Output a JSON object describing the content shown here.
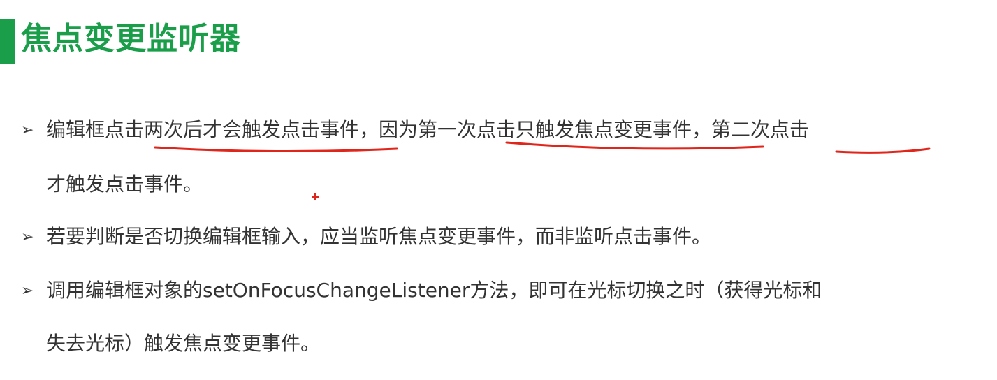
{
  "slide": {
    "title": "焦点变更监听器",
    "bullet_glyph": "➢",
    "bullets": [
      {
        "lines": [
          "编辑框点击两次后才会触发点击事件，因为第一次点击只触发焦点变更事件，第二次点击",
          "才触发点击事件。"
        ]
      },
      {
        "lines": [
          "若要判断是否切换编辑框输入，应当监听焦点变更事件，而非监听点击事件。"
        ]
      },
      {
        "lines": [
          "调用编辑框对象的setOnFocusChangeListener方法，即可在光标切换之时（获得光标和",
          "失去光标）触发焦点变更事件。"
        ]
      }
    ]
  },
  "colors": {
    "accent": "#1a9e4a",
    "text": "#333333",
    "annotation": "#e0251b"
  }
}
